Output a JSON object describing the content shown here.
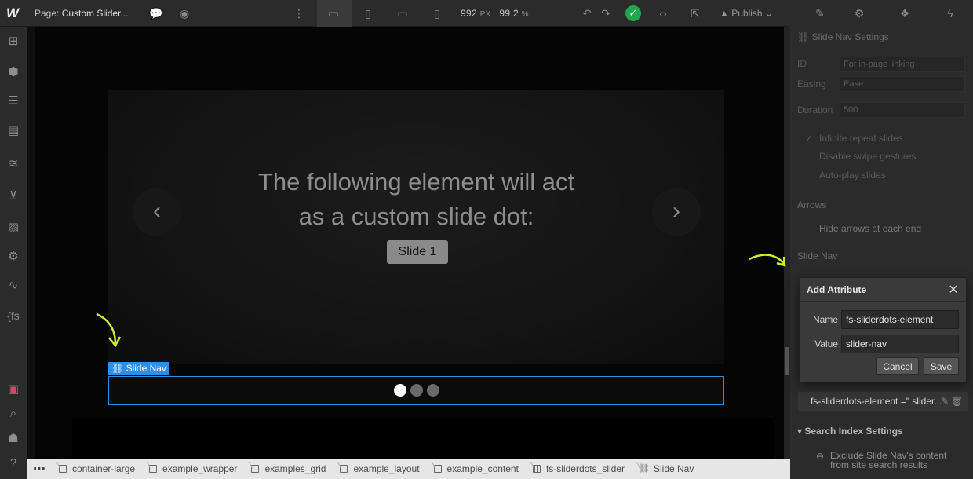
{
  "topbar": {
    "page_prefix": "Page:",
    "page_name": "Custom Slider...",
    "width_value": "992",
    "width_unit": "PX",
    "zoom_value": "99.2",
    "zoom_unit": "%",
    "publish_label": "Publish"
  },
  "canvas": {
    "headline_line1": "The following element will act",
    "headline_line2": "as a custom slide dot:",
    "slide_button": "Slide 1",
    "slide_nav_tag": "Slide Nav",
    "prev_arrow": "‹",
    "next_arrow": "›"
  },
  "right_panel": {
    "settings_title": "Slide Nav Settings",
    "id_label": "ID",
    "id_placeholder": "For in-page linking",
    "easing_label": "Easing",
    "easing_value": "Ease",
    "duration_label": "Duration",
    "duration_value": "500",
    "infinite_label": "Infinite repeat slides",
    "swipe_label": "Disable swipe gestures",
    "autoplay_label": "Auto-play slides",
    "arrows_section": "Arrows",
    "hide_arrows_label": "Hide arrows at each end",
    "slide_nav_section": "Slide Nav",
    "attribute_row": "fs-sliderdots-element =\" slider...",
    "search_index_title": "Search Index Settings",
    "exclude_line1": "Exclude Slide Nav's content",
    "exclude_line2": "from site search results"
  },
  "dialog": {
    "title": "Add Attribute",
    "name_label": "Name",
    "name_value": "fs-sliderdots-element",
    "value_label": "Value",
    "value_value": "slider-nav",
    "cancel_label": "Cancel",
    "save_label": "Save"
  },
  "breadcrumb": {
    "items": [
      {
        "label": "container-large",
        "icon": "box-icon"
      },
      {
        "label": "example_wrapper",
        "icon": "box-icon"
      },
      {
        "label": "examples_grid",
        "icon": "box-icon"
      },
      {
        "label": "example_layout",
        "icon": "box-icon"
      },
      {
        "label": "example_content",
        "icon": "box-icon"
      },
      {
        "label": "fs-sliderdots_slider",
        "icon": "slider-icon"
      },
      {
        "label": "Slide Nav",
        "icon": "link-icon"
      }
    ]
  },
  "colors": {
    "selection_blue": "#2d8fe4",
    "success_green": "#1ea84a",
    "annotation_arrow": "#c8f02c"
  }
}
